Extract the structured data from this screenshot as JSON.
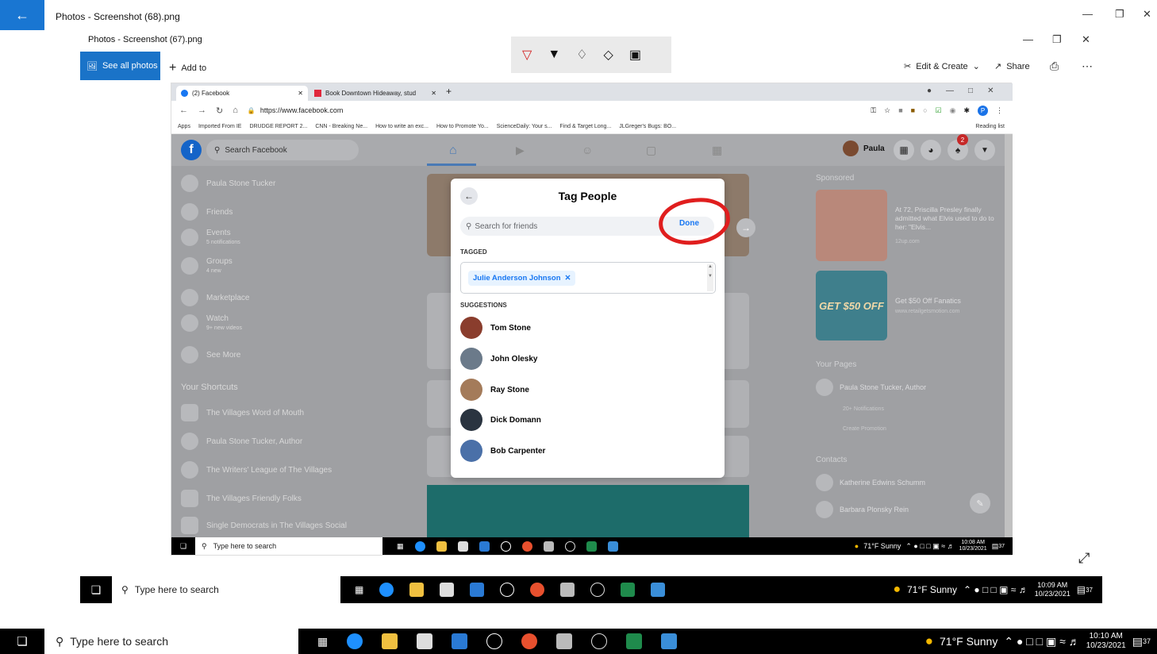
{
  "outer_window": {
    "title": "Photos - Screenshot (68).png"
  },
  "inner_window": {
    "title": "Photos - Screenshot (67).png",
    "see_all_photos": "See all photos",
    "add_to": "Add to",
    "edit_create": "Edit & Create",
    "share": "Share"
  },
  "browser": {
    "tabs": [
      {
        "label": "(2) Facebook"
      },
      {
        "label": "Book Downtown Hideaway, stud"
      }
    ],
    "url": "https://www.facebook.com",
    "bookmarks": [
      "Apps",
      "Imported From IE",
      "DRUDGE REPORT 2...",
      "CNN - Breaking Ne...",
      "How to write an exc...",
      "How to Promote Yo...",
      "ScienceDaily: Your s...",
      "Find & Target Long...",
      "JLGreger's Bugs: BO..."
    ],
    "reading_list": "Reading list"
  },
  "facebook": {
    "search_placeholder": "Search Facebook",
    "user_name": "Paula",
    "notification_count": "2",
    "left_nav": [
      {
        "label": "Paula Stone Tucker",
        "sub": ""
      },
      {
        "label": "Friends",
        "sub": ""
      },
      {
        "label": "Events",
        "sub": "5 notifications"
      },
      {
        "label": "Groups",
        "sub": "4 new"
      },
      {
        "label": "Marketplace",
        "sub": ""
      },
      {
        "label": "Watch",
        "sub": "9+ new videos"
      },
      {
        "label": "See More",
        "sub": ""
      }
    ],
    "shortcuts_header": "Your Shortcuts",
    "shortcuts": [
      "The Villages Word of Mouth",
      "Paula Stone Tucker, Author",
      "The Writers' League of The Villages",
      "The Villages Friendly Folks",
      "Single Democrats in The Villages Social"
    ],
    "sponsored_header": "Sponsored",
    "ads": [
      {
        "text": "At 72, Priscilla Presley finally admitted what Elvis used to do to her: \"Elvis...",
        "source": "12up.com"
      },
      {
        "text": "Get $50 Off Fanatics",
        "source": "www.retailgetsmotion.com"
      }
    ],
    "ad_banner": "GET $50 OFF",
    "your_pages_header": "Your Pages",
    "page_name": "Paula Stone Tucker, Author",
    "page_notifications": "20+ Notifications",
    "create_promotion": "Create Promotion",
    "contacts_header": "Contacts",
    "contacts": [
      "Katherine Edwins Schumm",
      "Barbara Plonsky Rein"
    ]
  },
  "tag_dialog": {
    "title": "Tag People",
    "search_placeholder": "Search for friends",
    "done": "Done",
    "tagged_label": "TAGGED",
    "tagged_person": "Julie Anderson Johnson",
    "suggestions_label": "SUGGESTIONS",
    "suggestions": [
      "Tom Stone",
      "John Olesky",
      "Ray Stone",
      "Dick Domann",
      "Bob Carpenter"
    ]
  },
  "taskbars": [
    {
      "search": "Type here to search",
      "weather": "71°F  Sunny",
      "time": "10:08 AM",
      "date": "10/23/2021",
      "notif": "37"
    },
    {
      "search": "Type here to search",
      "weather": "71°F  Sunny",
      "time": "10:09 AM",
      "date": "10/23/2021",
      "notif": "37"
    },
    {
      "search": "Type here to search",
      "weather": "71°F  Sunny",
      "time": "10:10 AM",
      "date": "10/23/2021",
      "notif": "37"
    }
  ],
  "colors": {
    "accent": "#1976d2",
    "facebook_blue": "#1877f2",
    "annotation_red": "#e01e1e"
  }
}
